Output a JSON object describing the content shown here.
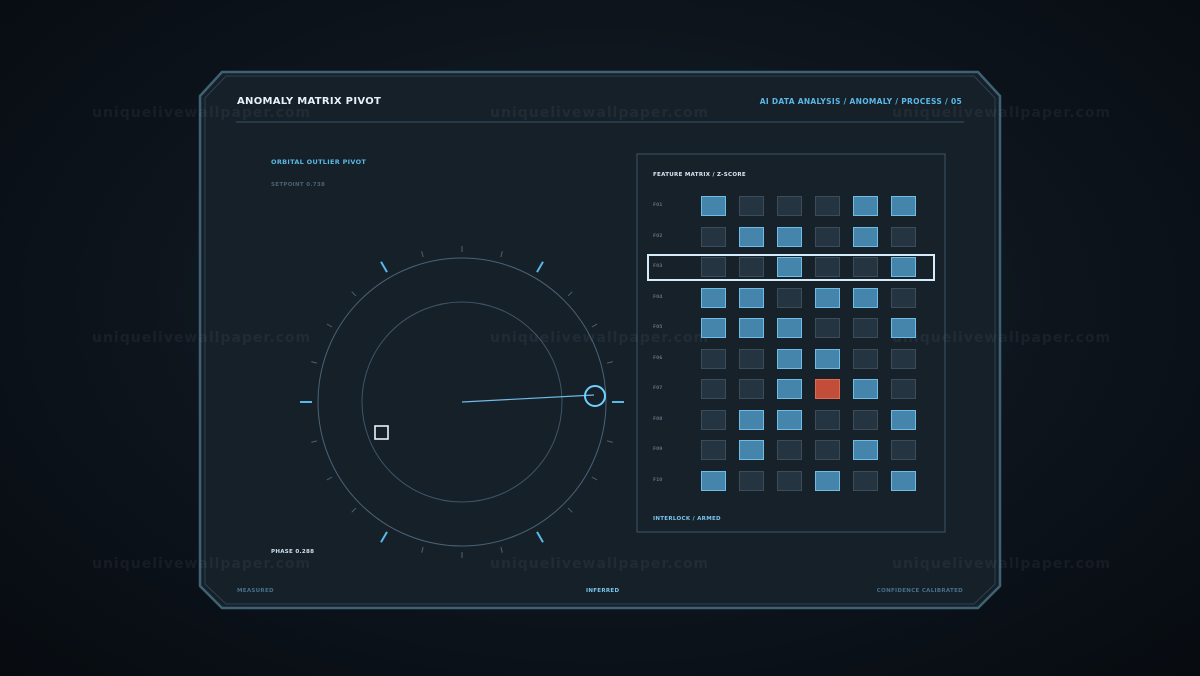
{
  "header": {
    "title": "ANOMALY MATRIX PIVOT",
    "breadcrumb": "AI DATA ANALYSIS / ANOMALY / PROCESS / 05"
  },
  "left_panel": {
    "section_title": "ORBITAL OUTLIER PIVOT",
    "setpoint": "SETPOINT 0.738",
    "phase": "PHASE 0.288"
  },
  "matrix": {
    "title": "FEATURE MATRIX / Z-SCORE",
    "footer": "INTERLOCK / ARMED",
    "selected_row": 2,
    "rows": [
      {
        "label": "F01",
        "cells": [
          1,
          0,
          0,
          0,
          1,
          1
        ]
      },
      {
        "label": "F02",
        "cells": [
          0,
          1,
          1,
          0,
          1,
          0
        ]
      },
      {
        "label": "F03",
        "cells": [
          0,
          0,
          1,
          0,
          0,
          1
        ]
      },
      {
        "label": "F04",
        "cells": [
          1,
          1,
          0,
          1,
          1,
          0
        ]
      },
      {
        "label": "F05",
        "cells": [
          1,
          1,
          1,
          0,
          0,
          1
        ]
      },
      {
        "label": "F06",
        "cells": [
          0,
          0,
          1,
          1,
          0,
          0
        ]
      },
      {
        "label": "F07",
        "cells": [
          0,
          0,
          1,
          2,
          1,
          0
        ]
      },
      {
        "label": "F08",
        "cells": [
          0,
          1,
          1,
          0,
          0,
          1
        ]
      },
      {
        "label": "F09",
        "cells": [
          0,
          1,
          0,
          0,
          1,
          0
        ]
      },
      {
        "label": "F10",
        "cells": [
          1,
          0,
          0,
          1,
          0,
          1
        ]
      }
    ]
  },
  "footer": {
    "left": "MEASURED",
    "center": "INFERRED",
    "right": "CONFIDENCE CALIBRATED"
  },
  "watermark": "uniquelivewallpaper.com",
  "colors": {
    "accent": "#5ab8e6",
    "cell_on": "#4585ab",
    "cell_off": "#253441",
    "alert": "#c24e3a",
    "panel": "#17212c"
  }
}
